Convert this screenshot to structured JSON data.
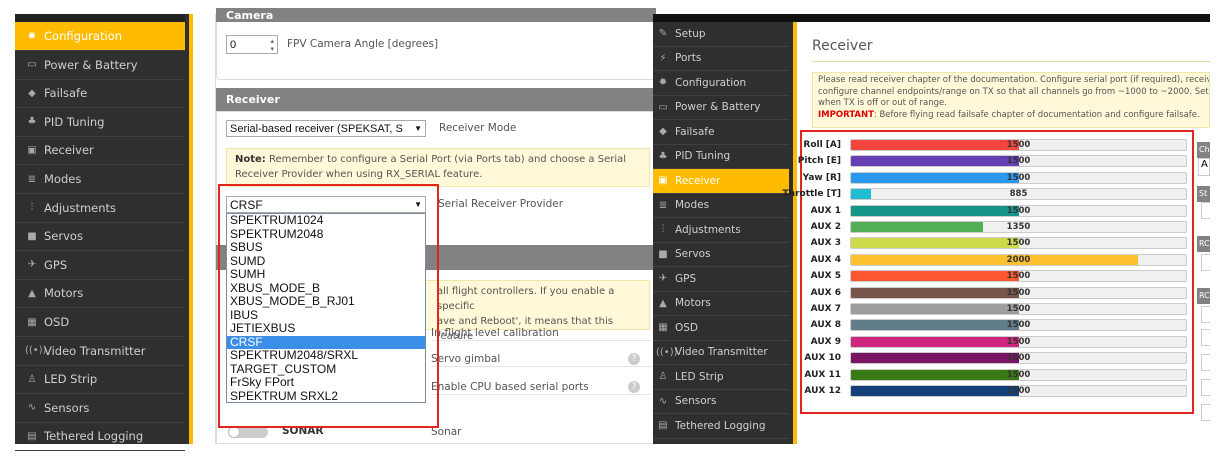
{
  "panel_config_sidebar": {
    "items": [
      {
        "label": "Configuration",
        "icon": "gear-icon",
        "active": true
      },
      {
        "label": "Power & Battery",
        "icon": "battery-icon"
      },
      {
        "label": "Failsafe",
        "icon": "parachute-icon"
      },
      {
        "label": "PID Tuning",
        "icon": "pid-icon"
      },
      {
        "label": "Receiver",
        "icon": "receiver-icon"
      },
      {
        "label": "Modes",
        "icon": "modes-icon"
      },
      {
        "label": "Adjustments",
        "icon": "sliders-icon"
      },
      {
        "label": "Servos",
        "icon": "servo-icon"
      },
      {
        "label": "GPS",
        "icon": "satellite-icon"
      },
      {
        "label": "Motors",
        "icon": "motor-icon"
      },
      {
        "label": "OSD",
        "icon": "osd-icon"
      },
      {
        "label": "Video Transmitter",
        "icon": "broadcast-icon"
      },
      {
        "label": "LED Strip",
        "icon": "led-icon"
      },
      {
        "label": "Sensors",
        "icon": "pulse-icon"
      },
      {
        "label": "Tethered Logging",
        "icon": "log-icon"
      }
    ]
  },
  "config": {
    "camera_header": "Camera",
    "camera_angle_value": "0",
    "camera_angle_label": "FPV Camera Angle [degrees]",
    "receiver_header": "Receiver",
    "receiver_mode_value": "Serial-based receiver (SPEKSAT, S",
    "receiver_mode_label": "Receiver Mode",
    "note_bold": "Note:",
    "note_text": " Remember to configure a Serial Port (via Ports tab) and choose a Serial Receiver Provider when using RX_SERIAL feature.",
    "provider_value": "CRSF",
    "provider_label": "Serial Receiver Provider",
    "provider_options": [
      "SPEKTRUM1024",
      "SPEKTRUM2048",
      "SBUS",
      "SUMD",
      "SUMH",
      "XBUS_MODE_B",
      "XBUS_MODE_B_RJ01",
      "IBUS",
      "JETIEXBUS",
      "CRSF",
      "SPEKTRUM2048/SRXL",
      "TARGET_CUSTOM",
      "FrSky FPort",
      "SPEKTRUM SRXL2"
    ],
    "provider_selected_index": 9,
    "other_note_line1": "all flight controllers. If you enable a specific",
    "other_note_line2": "ave and Reboot', it means that this feature",
    "feature_rows": [
      "In-flight level calibration",
      "Servo gimbal",
      "Enable CPU based serial ports"
    ],
    "sonar_name": "SONAR",
    "sonar_desc": "Sonar"
  },
  "panel_receiver_sidebar": {
    "items": [
      {
        "label": "Setup",
        "icon": "wrench-icon"
      },
      {
        "label": "Ports",
        "icon": "plug-icon"
      },
      {
        "label": "Configuration",
        "icon": "gear-icon"
      },
      {
        "label": "Power & Battery",
        "icon": "battery-icon"
      },
      {
        "label": "Failsafe",
        "icon": "parachute-icon"
      },
      {
        "label": "PID Tuning",
        "icon": "pid-icon"
      },
      {
        "label": "Receiver",
        "icon": "receiver-icon",
        "active": true
      },
      {
        "label": "Modes",
        "icon": "modes-icon"
      },
      {
        "label": "Adjustments",
        "icon": "sliders-icon"
      },
      {
        "label": "Servos",
        "icon": "servo-icon"
      },
      {
        "label": "GPS",
        "icon": "satellite-icon"
      },
      {
        "label": "Motors",
        "icon": "motor-icon"
      },
      {
        "label": "OSD",
        "icon": "osd-icon"
      },
      {
        "label": "Video Transmitter",
        "icon": "broadcast-icon"
      },
      {
        "label": "LED Strip",
        "icon": "led-icon"
      },
      {
        "label": "Sensors",
        "icon": "pulse-icon"
      },
      {
        "label": "Tethered Logging",
        "icon": "log-icon"
      }
    ]
  },
  "receiver": {
    "title": "Receiver",
    "info_line1": "Please read receiver chapter of the documentation. Configure serial port (if required), receiver m",
    "info_line2": "configure channel endpoints/range on TX so that all channels go from ~1000 to ~2000. Set midp",
    "info_line3": "when TX is off or out of range.",
    "important_label": "IMPORTANT",
    "important_text": ": Before flying read failsafe chapter of documentation and configure failsafe.",
    "range": [
      800,
      2200
    ],
    "channels": [
      {
        "name": "Roll [A]",
        "value": 1500,
        "color": "#f1453d"
      },
      {
        "name": "Pitch [E]",
        "value": 1500,
        "color": "#673fb4"
      },
      {
        "name": "Yaw [R]",
        "value": 1500,
        "color": "#2b98f0"
      },
      {
        "name": "Throttle [T]",
        "value": 885,
        "color": "#1fbcd2"
      },
      {
        "name": "AUX 1",
        "value": 1500,
        "color": "#159588"
      },
      {
        "name": "AUX 2",
        "value": 1350,
        "color": "#50ae55"
      },
      {
        "name": "AUX 3",
        "value": 1500,
        "color": "#cdda49"
      },
      {
        "name": "AUX 4",
        "value": 2000,
        "color": "#fdc02f"
      },
      {
        "name": "AUX 5",
        "value": 1500,
        "color": "#fc5830"
      },
      {
        "name": "AUX 6",
        "value": 1500,
        "color": "#785549"
      },
      {
        "name": "AUX 7",
        "value": 1500,
        "color": "#9e9e9e"
      },
      {
        "name": "AUX 8",
        "value": 1500,
        "color": "#617d8a"
      },
      {
        "name": "AUX 9",
        "value": 1500,
        "color": "#cf267d"
      },
      {
        "name": "AUX 10",
        "value": 1500,
        "color": "#7a1464"
      },
      {
        "name": "AUX 11",
        "value": 1500,
        "color": "#3a7a14"
      },
      {
        "name": "AUX 12",
        "value": 1500,
        "color": "#14407a"
      }
    ],
    "side_headers": [
      "Ch",
      "St",
      "RC",
      "RC"
    ],
    "side_value": "A"
  }
}
